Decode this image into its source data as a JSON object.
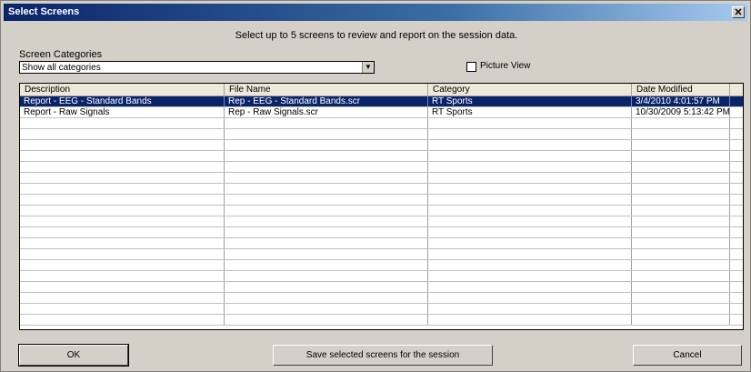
{
  "window": {
    "title": "Select Screens",
    "close_glyph": "✕"
  },
  "instruction": "Select up to 5 screens to review and report on the session data.",
  "categories": {
    "label": "Screen Categories",
    "selected": "Show all categories"
  },
  "picture_view": {
    "label": "Picture View",
    "checked": false
  },
  "table": {
    "columns": [
      "Description",
      "File Name",
      "Category",
      "Date Modified"
    ],
    "rows": [
      [
        "Report - EEG - Standard Bands",
        "Rep - EEG - Standard Bands.scr",
        "RT Sports",
        "3/4/2010 4:01:57 PM"
      ],
      [
        "Report - Raw Signals",
        "Rep - Raw Signals.scr",
        "RT Sports",
        "10/30/2009 5:13:42 PM"
      ]
    ],
    "selected_row_index": 0
  },
  "buttons": {
    "ok": "OK",
    "save": "Save selected screens for the session",
    "cancel": "Cancel"
  },
  "colors": {
    "selection": "#0a246a",
    "face": "#d4d0c8"
  }
}
